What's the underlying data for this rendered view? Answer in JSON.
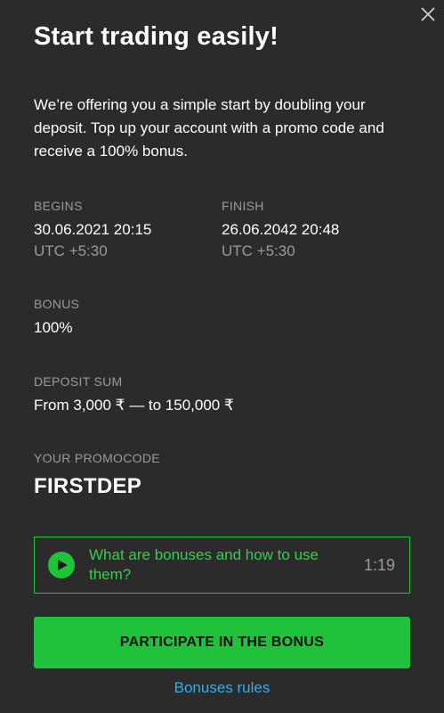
{
  "header": {
    "title": "Start trading easily!",
    "close_icon": "close-icon"
  },
  "intro": "We’re offering you a simple start by doubling your deposit. Top up your account with a promo code and receive a 100% bonus.",
  "begins": {
    "label": "BEGINS",
    "datetime": "30.06.2021 20:15",
    "timezone": "UTC +5:30"
  },
  "finish": {
    "label": "FINISH",
    "datetime": "26.06.2042 20:48",
    "timezone": "UTC +5:30"
  },
  "bonus": {
    "label": "BONUS",
    "value": "100%"
  },
  "deposit": {
    "label": "DEPOSIT SUM",
    "value": "From 3,000 ₹ — to 150,000 ₹"
  },
  "promo": {
    "label": "YOUR PROMOCODE",
    "code": "FIRSTDEP"
  },
  "video": {
    "icon": "play-icon",
    "title": "What are bonuses and how to use them?",
    "duration": "1:19"
  },
  "actions": {
    "participate_label": "PARTICIPATE IN THE BONUS",
    "rules_label": "Bonuses rules"
  },
  "colors": {
    "background": "#2b2b2b",
    "accent_green": "#1fc23a",
    "link_blue": "#33aee8",
    "muted": "#9a9a9a"
  }
}
